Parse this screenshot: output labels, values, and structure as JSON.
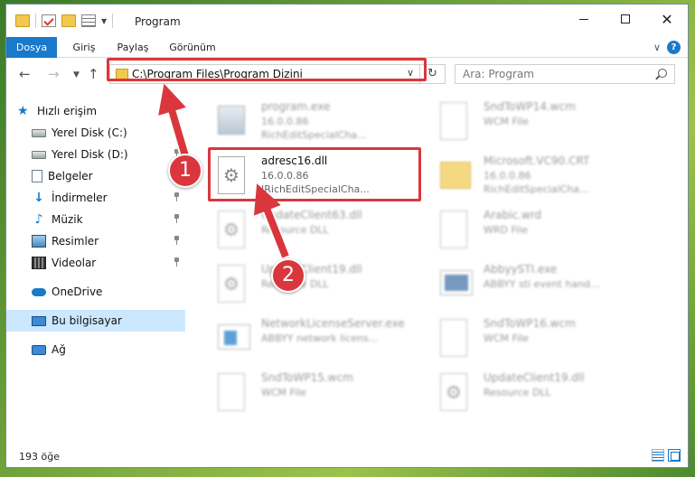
{
  "window": {
    "title": "Program"
  },
  "ribbon": {
    "tabs": [
      {
        "label": "Dosya"
      },
      {
        "label": "Giriş"
      },
      {
        "label": "Paylaş"
      },
      {
        "label": "Görünüm"
      }
    ],
    "help": "?"
  },
  "nav": {
    "address": "C:\\Program Files\\Program Dizini",
    "search_placeholder": "Ara: Program"
  },
  "sidebar": {
    "items": [
      {
        "label": "Hızlı erişim",
        "icon": "star-icon"
      },
      {
        "label": "Yerel Disk (C:)",
        "icon": "disk-icon"
      },
      {
        "label": "Yerel Disk (D:)",
        "icon": "disk-icon"
      },
      {
        "label": "Belgeler",
        "icon": "documents-icon"
      },
      {
        "label": "İndirmeler",
        "icon": "download-icon"
      },
      {
        "label": "Müzik",
        "icon": "music-icon"
      },
      {
        "label": "Resimler",
        "icon": "pictures-icon"
      },
      {
        "label": "Videolar",
        "icon": "videos-icon"
      },
      {
        "label": "OneDrive",
        "icon": "cloud-icon"
      },
      {
        "label": "Bu bilgisayar",
        "icon": "computer-icon"
      },
      {
        "label": "Ağ",
        "icon": "network-icon"
      }
    ]
  },
  "files": [
    {
      "name": "program.exe",
      "line2": "16.0.0.86",
      "line3": "RichEditSpecialCha..."
    },
    {
      "name": "SndToWP14.wcm",
      "line2": "WCM File",
      "line3": ""
    },
    {
      "name": "adresc16.dll",
      "line2": "16.0.0.86",
      "line3": "IRichEditSpecialCha..."
    },
    {
      "name": "Microsoft.VC90.CRT",
      "line2": "16.0.0.86",
      "line3": "RichEditSpecialCha..."
    },
    {
      "name": "UpdateClient63.dll",
      "line2": "Resource DLL",
      "line3": ""
    },
    {
      "name": "Arabic.wrd",
      "line2": "WRD File",
      "line3": ""
    },
    {
      "name": "UpdateClient19.dll",
      "line2": "Resource DLL",
      "line3": ""
    },
    {
      "name": "AbbyySTI.exe",
      "line2": "ABBYY sti event hand...",
      "line3": ""
    },
    {
      "name": "NetworkLicenseServer.exe",
      "line2": "ABBYY network licens...",
      "line3": ""
    },
    {
      "name": "SndToWP16.wcm",
      "line2": "WCM File",
      "line3": ""
    },
    {
      "name": "SndToWP15.wcm",
      "line2": "WCM File",
      "line3": ""
    },
    {
      "name": "UpdateClient19.dll",
      "line2": "Resource DLL",
      "line3": ""
    }
  ],
  "annotations": {
    "step1": "1",
    "step2": "2",
    "color": "#d9373d"
  },
  "status": {
    "count": "193 öğe"
  }
}
